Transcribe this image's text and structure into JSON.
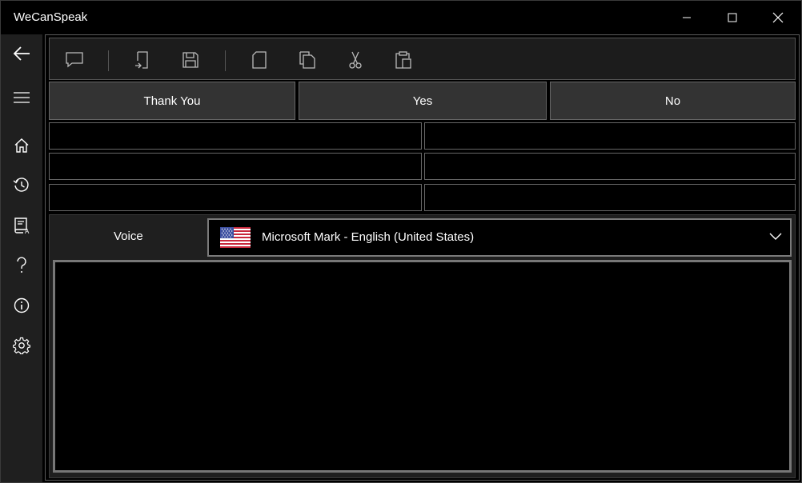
{
  "app": {
    "title": "WeCanSpeak"
  },
  "window_controls": {
    "minimize": "minimize-icon",
    "maximize": "maximize-icon",
    "close": "close-icon"
  },
  "sidebar": {
    "items": [
      {
        "icon": "back-arrow-icon"
      },
      {
        "icon": "hamburger-menu-icon"
      },
      {
        "icon": "home-icon"
      },
      {
        "icon": "history-icon"
      },
      {
        "icon": "phrasebook-icon"
      },
      {
        "icon": "help-icon"
      },
      {
        "icon": "info-icon"
      },
      {
        "icon": "settings-gear-icon"
      }
    ]
  },
  "toolbar": {
    "tools": [
      {
        "icon": "speak-bubble-icon"
      },
      {
        "icon": "open-file-icon"
      },
      {
        "icon": "save-icon"
      },
      {
        "icon": "new-document-icon"
      },
      {
        "icon": "copy-icon"
      },
      {
        "icon": "cut-icon"
      },
      {
        "icon": "paste-icon"
      }
    ]
  },
  "quick_phrases": [
    {
      "label": "Thank You"
    },
    {
      "label": "Yes"
    },
    {
      "label": "No"
    }
  ],
  "phrase_fields": [
    "",
    "",
    "",
    "",
    "",
    ""
  ],
  "voice": {
    "label": "Voice",
    "selected": "Microsoft Mark - English (United States)",
    "flag": "us-flag-icon"
  },
  "speech_text": ""
}
